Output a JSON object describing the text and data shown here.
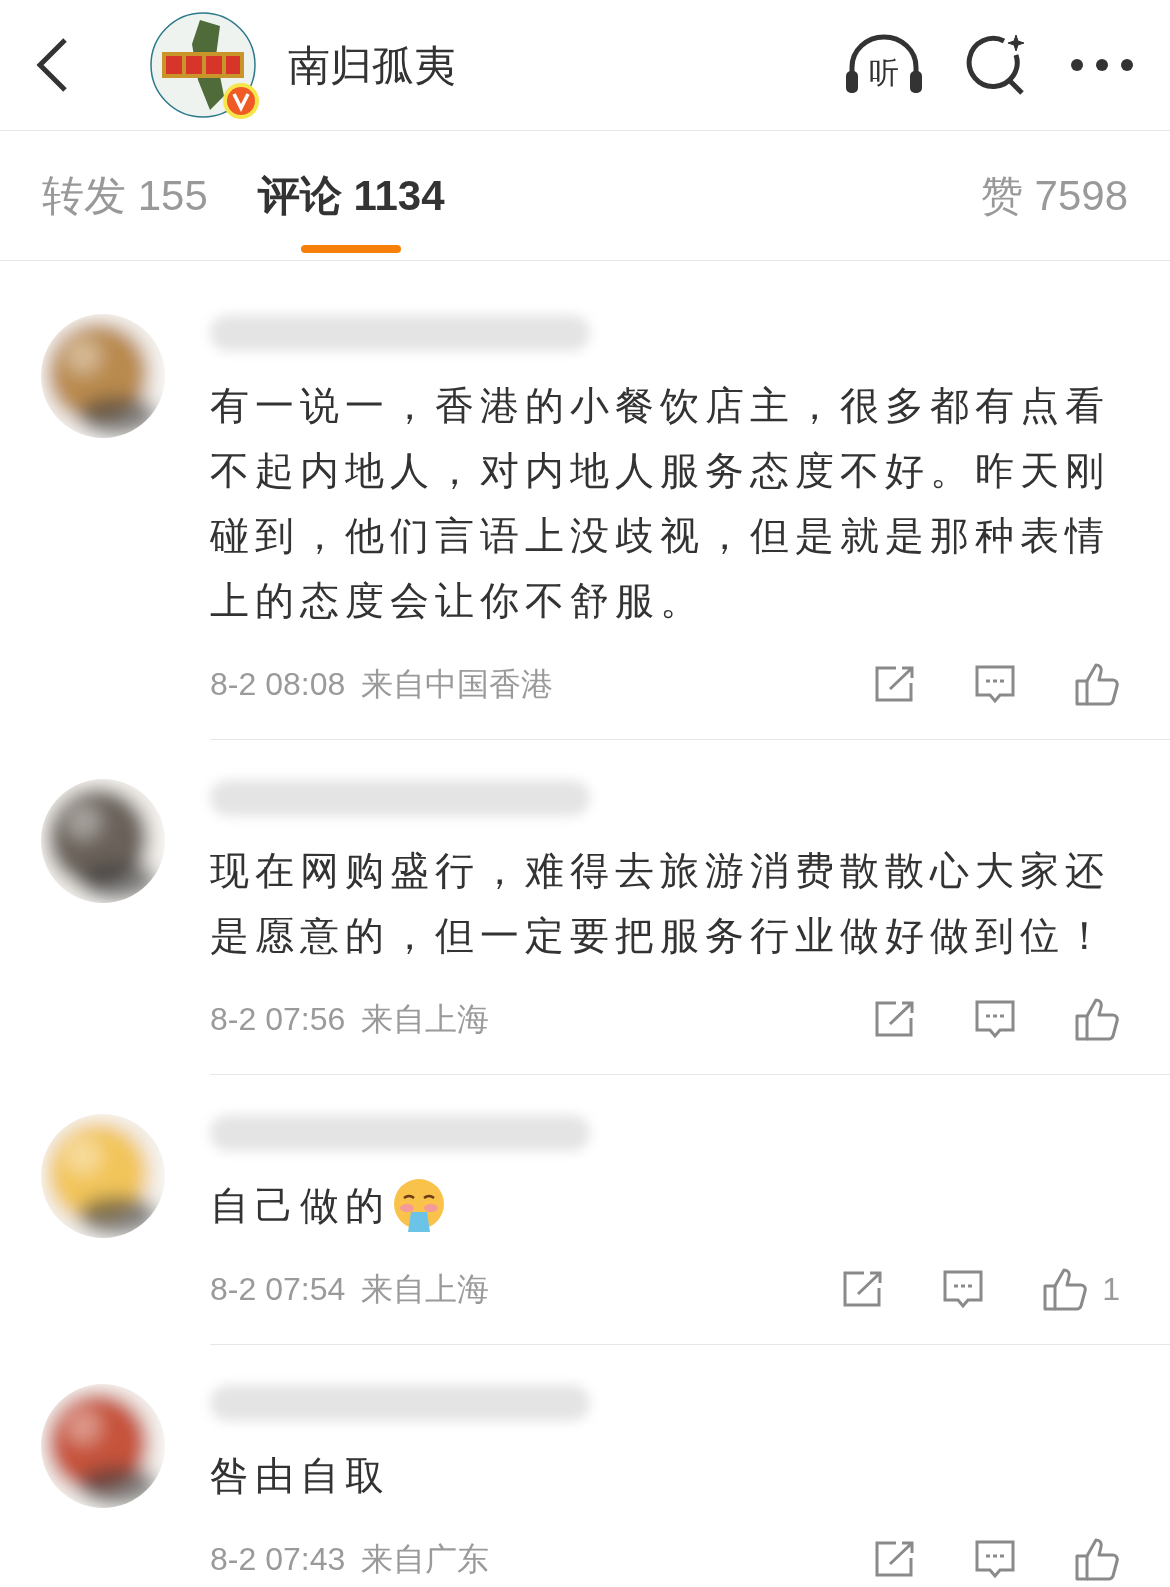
{
  "header": {
    "title": "南归孤夷",
    "verified": true,
    "listen_label": "听"
  },
  "tabs": [
    {
      "label": "转发 155",
      "selected": false
    },
    {
      "label": "评论 1134",
      "selected": true
    },
    {
      "label": "赞 7598",
      "selected": false
    }
  ],
  "comments": [
    {
      "text": "有一说一，香港的小餐饮店主，很多都有点看不起内地人，对内地人服务态度不好。昨天刚碰到，他们言语上没歧视，但是就是那种表情上的态度会让你不舒服。",
      "emoji": false,
      "time": "8-2 08:08",
      "location": "来自中国香港"
    },
    {
      "text": "现在网购盛行，难得去旅游消费散散心大家还是愿意的，但一定要把服务行业做好做到位！",
      "emoji": false,
      "time": "8-2 07:56",
      "location": "来自上海"
    },
    {
      "text": "自己做的",
      "emoji": true,
      "time": "8-2 07:54",
      "location": "来自上海",
      "likes": "1"
    },
    {
      "text": "咎由自取",
      "emoji": false,
      "time": "8-2 07:43",
      "location": "来自广东"
    }
  ]
}
